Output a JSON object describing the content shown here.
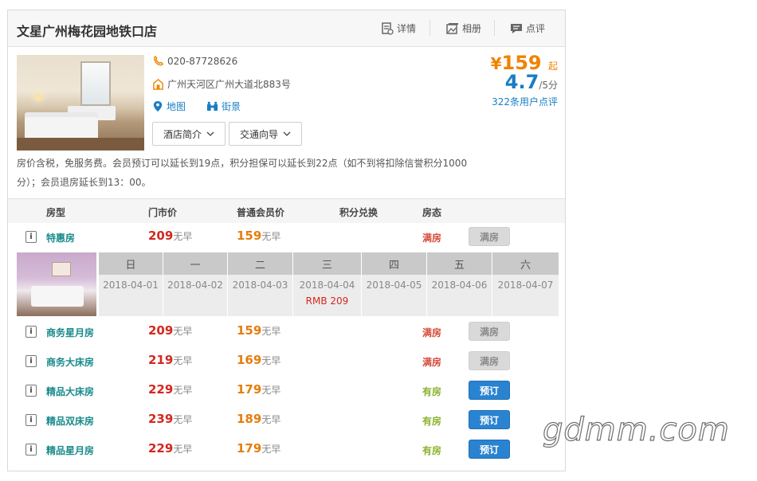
{
  "hotel": {
    "name": "文星广州梅花园地铁口店",
    "tabs": [
      {
        "label": "详情",
        "icon": "details-icon"
      },
      {
        "label": "相册",
        "icon": "photo-album-icon"
      },
      {
        "label": "点评",
        "icon": "comment-icon"
      }
    ],
    "phone": "020-87728626",
    "address": "广州天河区广州大道北883号",
    "map_label": "地图",
    "street_label": "街景",
    "dropdowns": [
      "酒店简介",
      "交通向导"
    ],
    "price": {
      "currency": "¥",
      "amount": "159",
      "suffix": "起"
    },
    "score": {
      "value": "4.7",
      "scale": "/5分"
    },
    "reviews": "322条用户点评",
    "description": "房价含税，免服务费。会员预订可以延长到19点，积分担保可以延长到22点（如不到将扣除信誉积分1000分）；会员退房延长到13：00。"
  },
  "table": {
    "headers": [
      "房型",
      "门市价",
      "普通会员价",
      "积分兑换",
      "房态"
    ],
    "rooms": [
      {
        "name": "特惠房",
        "market": "209",
        "member": "159",
        "breakfast": "无早",
        "status": "满房",
        "button": "满房",
        "available": false
      },
      {
        "name": "商务星月房",
        "market": "209",
        "member": "159",
        "breakfast": "无早",
        "status": "满房",
        "button": "满房",
        "available": false
      },
      {
        "name": "商务大床房",
        "market": "219",
        "member": "169",
        "breakfast": "无早",
        "status": "满房",
        "button": "满房",
        "available": false
      },
      {
        "name": "精品大床房",
        "market": "229",
        "member": "179",
        "breakfast": "无早",
        "status": "有房",
        "button": "预订",
        "available": true
      },
      {
        "name": "精品双床房",
        "market": "239",
        "member": "189",
        "breakfast": "无早",
        "status": "有房",
        "button": "预订",
        "available": true
      },
      {
        "name": "精品星月房",
        "market": "229",
        "member": "179",
        "breakfast": "无早",
        "status": "有房",
        "button": "预订",
        "available": true
      }
    ],
    "info_glyph": "i"
  },
  "calendar": {
    "days": [
      {
        "day": "日",
        "date": "2018-04-01",
        "price": ""
      },
      {
        "day": "一",
        "date": "2018-04-02",
        "price": ""
      },
      {
        "day": "二",
        "date": "2018-04-03",
        "price": ""
      },
      {
        "day": "三",
        "date": "2018-04-04",
        "price": "RMB  209"
      },
      {
        "day": "四",
        "date": "2018-04-05",
        "price": ""
      },
      {
        "day": "五",
        "date": "2018-04-06",
        "price": ""
      },
      {
        "day": "六",
        "date": "2018-04-07",
        "price": ""
      }
    ]
  },
  "watermark": "gdmm.com",
  "colors": {
    "orange": "#f08300",
    "blue": "#1a7dc4",
    "red": "#d4281f",
    "teal": "#1a8a8a",
    "green": "#8ab32b",
    "book": "#2a83d0"
  }
}
